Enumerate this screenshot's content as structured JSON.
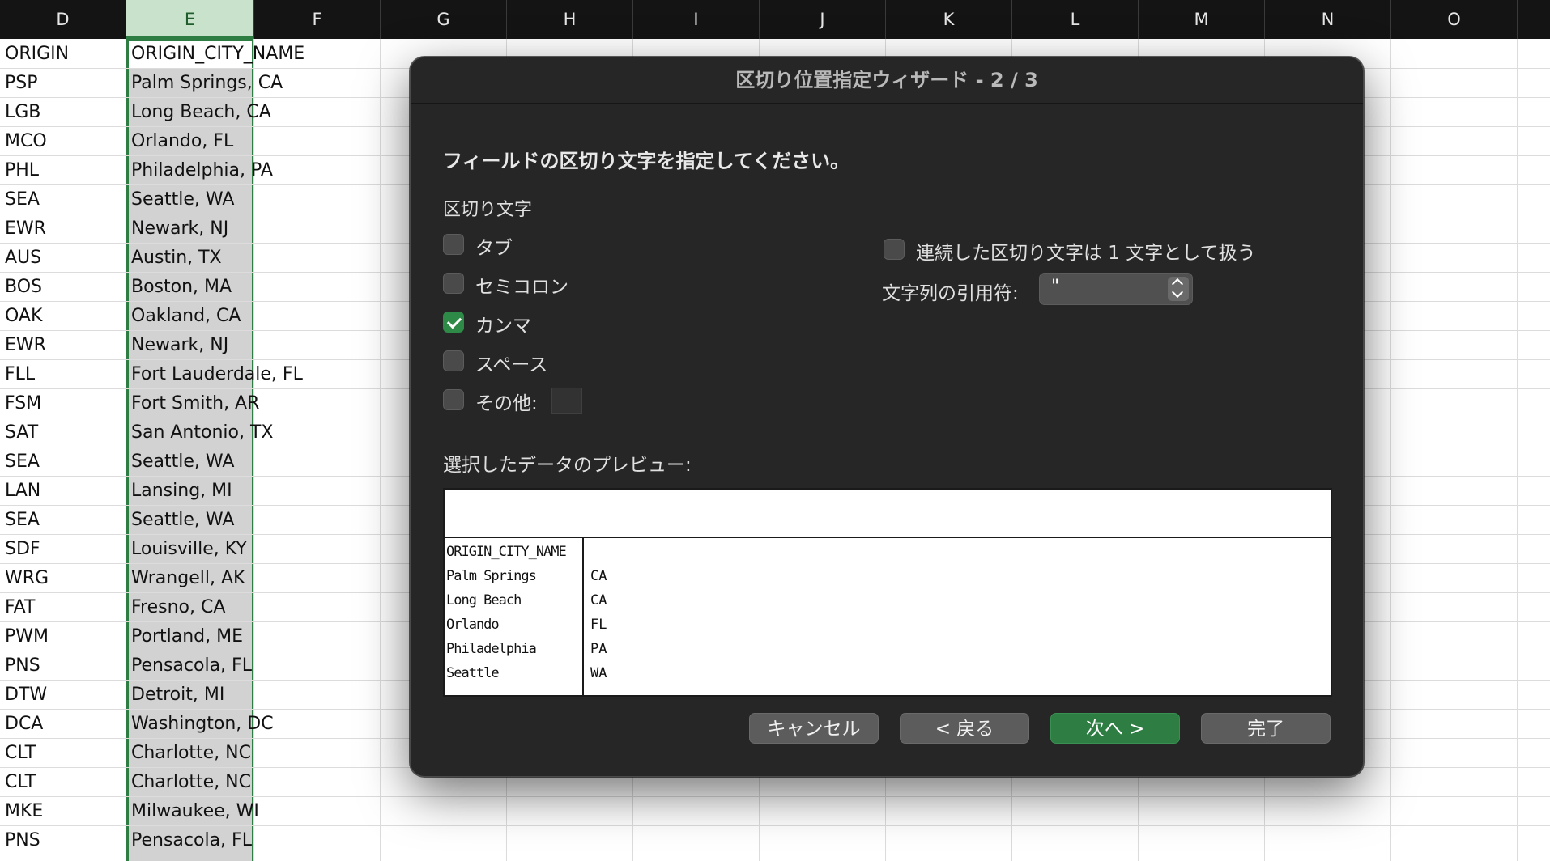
{
  "sheet": {
    "columns": [
      "D",
      "E",
      "F",
      "G",
      "H",
      "I",
      "J",
      "K",
      "L",
      "M",
      "N",
      "O"
    ],
    "rows": [
      {
        "d": "ORIGIN",
        "e": "ORIGIN_CITY_NAME"
      },
      {
        "d": "PSP",
        "e": "Palm Springs, CA"
      },
      {
        "d": "LGB",
        "e": "Long Beach, CA"
      },
      {
        "d": "MCO",
        "e": "Orlando, FL"
      },
      {
        "d": "PHL",
        "e": "Philadelphia, PA"
      },
      {
        "d": "SEA",
        "e": "Seattle, WA"
      },
      {
        "d": "EWR",
        "e": "Newark, NJ"
      },
      {
        "d": "AUS",
        "e": "Austin, TX"
      },
      {
        "d": "BOS",
        "e": "Boston, MA"
      },
      {
        "d": "OAK",
        "e": "Oakland, CA"
      },
      {
        "d": "EWR",
        "e": "Newark, NJ"
      },
      {
        "d": "FLL",
        "e": "Fort Lauderdale, FL"
      },
      {
        "d": "FSM",
        "e": "Fort Smith, AR"
      },
      {
        "d": "SAT",
        "e": "San Antonio, TX"
      },
      {
        "d": "SEA",
        "e": "Seattle, WA"
      },
      {
        "d": "LAN",
        "e": "Lansing, MI"
      },
      {
        "d": "SEA",
        "e": "Seattle, WA"
      },
      {
        "d": "SDF",
        "e": "Louisville, KY"
      },
      {
        "d": "WRG",
        "e": "Wrangell, AK"
      },
      {
        "d": "FAT",
        "e": "Fresno, CA"
      },
      {
        "d": "PWM",
        "e": "Portland, ME"
      },
      {
        "d": "PNS",
        "e": "Pensacola, FL"
      },
      {
        "d": "DTW",
        "e": "Detroit, MI"
      },
      {
        "d": "DCA",
        "e": "Washington, DC"
      },
      {
        "d": "CLT",
        "e": "Charlotte, NC"
      },
      {
        "d": "CLT",
        "e": "Charlotte, NC"
      },
      {
        "d": "MKE",
        "e": "Milwaukee, WI"
      },
      {
        "d": "PNS",
        "e": "Pensacola, FL"
      }
    ],
    "selected_column": "E",
    "accent_color": "#2e7d43"
  },
  "dialog": {
    "title": "区切り位置指定ウィザード - 2 / 3",
    "instruction": "フィールドの区切り文字を指定してください。",
    "delimiters_label": "区切り文字",
    "delimiters": [
      {
        "label": "タブ",
        "checked": false
      },
      {
        "label": "セミコロン",
        "checked": false
      },
      {
        "label": "カンマ",
        "checked": true
      },
      {
        "label": "スペース",
        "checked": false
      },
      {
        "label": "その他:",
        "checked": false
      }
    ],
    "consecutive_label": "連続した区切り文字は 1 文字として扱う",
    "consecutive_checked": false,
    "quote_label": "文字列の引用符:",
    "quote_value": "\"",
    "preview_label": "選択したデータのプレビュー:",
    "preview_rows": [
      {
        "c1": "ORIGIN_CITY_NAME",
        "c2": ""
      },
      {
        "c1": "Palm Springs",
        "c2": "CA"
      },
      {
        "c1": "Long Beach",
        "c2": "CA"
      },
      {
        "c1": "Orlando",
        "c2": "FL"
      },
      {
        "c1": "Philadelphia",
        "c2": "PA"
      },
      {
        "c1": "Seattle",
        "c2": "WA"
      }
    ],
    "buttons": {
      "cancel": "キャンセル",
      "back": "< 戻る",
      "next": "次へ >",
      "finish": "完了"
    },
    "primary_color": "#2e7d43"
  }
}
